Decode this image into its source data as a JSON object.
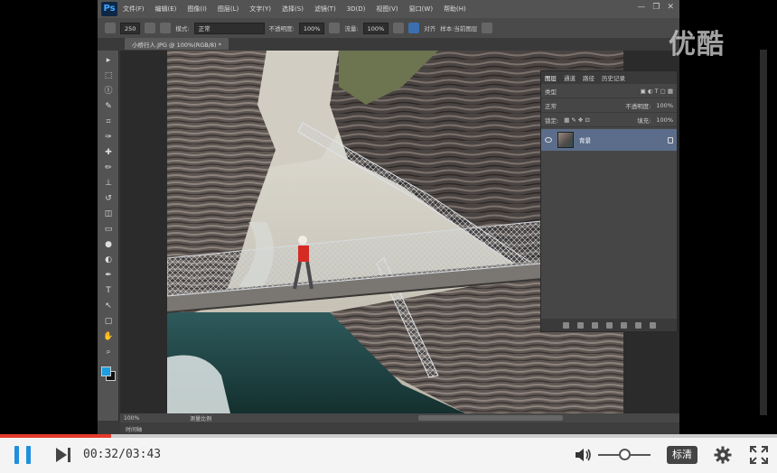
{
  "watermark": "优酷",
  "photoshop": {
    "logo": "Ps",
    "menu": [
      "文件(F)",
      "编辑(E)",
      "图像(I)",
      "图层(L)",
      "文字(Y)",
      "选择(S)",
      "滤镜(T)",
      "3D(D)",
      "视图(V)",
      "窗口(W)",
      "帮助(H)"
    ],
    "options": {
      "brush_size": "250",
      "mode": "正常",
      "opacity_label": "不透明度:",
      "opacity_value": "100%",
      "flow_label": "流量:",
      "flow_value": "100%",
      "aligned_label": "对齐",
      "sample_label": "样本:当前图层"
    },
    "doc_tab": "小桥行人.JPG @ 100%(RGB/8) *",
    "status": {
      "zoom": "100%",
      "doc_info": "测量比例"
    },
    "timeline_label": "时间轴",
    "layers_panel": {
      "tabs": [
        "图层",
        "通道",
        "路径",
        "历史记录"
      ],
      "kind_label": "类型",
      "blend_mode": "正常",
      "opacity_label": "不透明度:",
      "opacity_value": "100%",
      "lock_label": "锁定:",
      "fill_label": "填充:",
      "fill_value": "100%",
      "layer_name": "背景"
    }
  },
  "player": {
    "current_time": "00:32",
    "total_time": "03:43",
    "time_display": "00:32/03:43",
    "progress_fraction": 0.143,
    "quality_label": "标清",
    "accent_color": "#e53a2c",
    "play_color": "#1f8fde"
  }
}
